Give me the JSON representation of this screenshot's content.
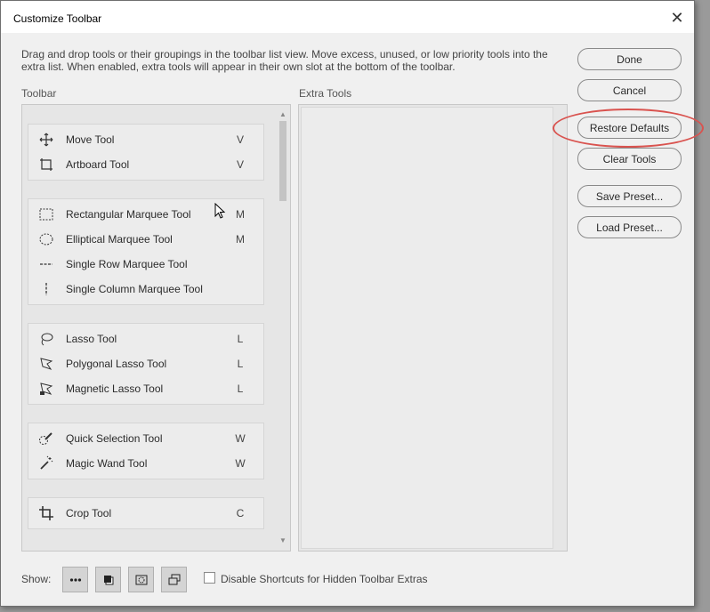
{
  "window": {
    "title": "Customize Toolbar",
    "close_glyph": "✕"
  },
  "description": "Drag and drop tools or their groupings in the toolbar list view. Move excess, unused, or low priority tools into the extra list. When enabled, extra tools will appear in their own slot at the bottom of the toolbar.",
  "columns": {
    "toolbar_label": "Toolbar",
    "extra_label": "Extra Tools"
  },
  "tool_groups": [
    {
      "tools": [
        {
          "name": "Move Tool",
          "key": "V",
          "icon": "move-icon"
        },
        {
          "name": "Artboard Tool",
          "key": "V",
          "icon": "artboard-icon"
        }
      ]
    },
    {
      "tools": [
        {
          "name": "Rectangular Marquee Tool",
          "key": "M",
          "icon": "rect-marquee-icon"
        },
        {
          "name": "Elliptical Marquee Tool",
          "key": "M",
          "icon": "ellipse-marquee-icon"
        },
        {
          "name": "Single Row Marquee Tool",
          "key": "",
          "icon": "row-marquee-icon"
        },
        {
          "name": "Single Column Marquee Tool",
          "key": "",
          "icon": "column-marquee-icon"
        }
      ]
    },
    {
      "tools": [
        {
          "name": "Lasso Tool",
          "key": "L",
          "icon": "lasso-icon"
        },
        {
          "name": "Polygonal Lasso Tool",
          "key": "L",
          "icon": "polygonal-lasso-icon"
        },
        {
          "name": "Magnetic Lasso Tool",
          "key": "L",
          "icon": "magnetic-lasso-icon"
        }
      ]
    },
    {
      "tools": [
        {
          "name": "Quick Selection Tool",
          "key": "W",
          "icon": "quick-selection-icon"
        },
        {
          "name": "Magic Wand Tool",
          "key": "W",
          "icon": "magic-wand-icon"
        }
      ]
    },
    {
      "tools": [
        {
          "name": "Crop Tool",
          "key": "C",
          "icon": "crop-icon"
        }
      ]
    }
  ],
  "buttons": {
    "done": "Done",
    "cancel": "Cancel",
    "restore_defaults": "Restore Defaults",
    "clear_tools": "Clear Tools",
    "save_preset": "Save Preset...",
    "load_preset": "Load Preset..."
  },
  "bottom": {
    "show_label": "Show:",
    "show_buttons": [
      "extra-tools-icon",
      "foreground-background-icon",
      "quick-mask-icon",
      "screen-mode-icon"
    ],
    "checkbox_label": "Disable Shortcuts for Hidden Toolbar Extras",
    "checkbox_checked": false
  },
  "colors": {
    "highlight": "#d9534f",
    "dialog_bg": "#f0f0f0"
  }
}
